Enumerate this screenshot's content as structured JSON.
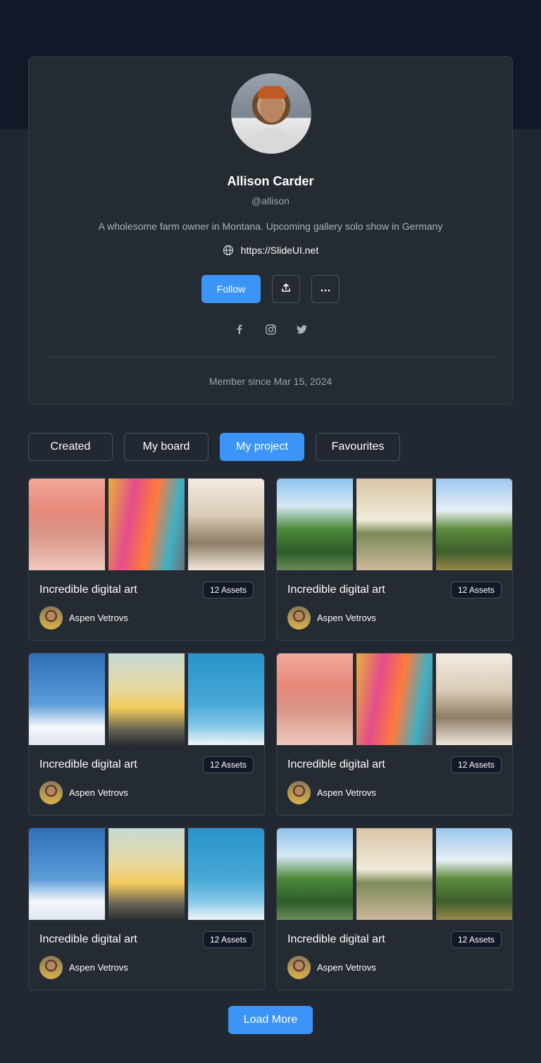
{
  "profile": {
    "name": "Allison Carder",
    "handle": "@allison",
    "bio": "A wholesome farm owner in Montana. Upcoming gallery solo show in Germany",
    "website": "https://SlideUI.net",
    "follow_label": "Follow",
    "member_since": "Member since Mar 15, 2024",
    "socials": [
      "facebook-icon",
      "instagram-icon",
      "twitter-icon"
    ]
  },
  "tabs": [
    {
      "label": "Created",
      "active": false
    },
    {
      "label": "My board",
      "active": false
    },
    {
      "label": "My project",
      "active": true
    },
    {
      "label": "Favourites",
      "active": false
    }
  ],
  "cards": [
    {
      "title": "Incredible digital art",
      "assets": "12 Assets",
      "author": "Aspen Vetrovs",
      "thumbs": [
        "t-pink",
        "t-bags",
        "t-mall"
      ]
    },
    {
      "title": "Incredible digital art",
      "assets": "12 Assets",
      "author": "Aspen Vetrovs",
      "thumbs": [
        "t-garden",
        "t-room",
        "t-house"
      ]
    },
    {
      "title": "Incredible digital art",
      "assets": "12 Assets",
      "author": "Aspen Vetrovs",
      "thumbs": [
        "t-sky",
        "t-run",
        "t-jump"
      ]
    },
    {
      "title": "Incredible digital art",
      "assets": "12 Assets",
      "author": "Aspen Vetrovs",
      "thumbs": [
        "t-pink",
        "t-bags",
        "t-mall"
      ]
    },
    {
      "title": "Incredible digital art",
      "assets": "12 Assets",
      "author": "Aspen Vetrovs",
      "thumbs": [
        "t-sky",
        "t-run",
        "t-jump"
      ]
    },
    {
      "title": "Incredible digital art",
      "assets": "12 Assets",
      "author": "Aspen Vetrovs",
      "thumbs": [
        "t-garden",
        "t-room",
        "t-house"
      ]
    }
  ],
  "load_more_label": "Load More",
  "colors": {
    "accent": "#3b94f6",
    "page_bg": "#222831",
    "header_band": "#111827",
    "card_bg": "#252b33",
    "border": "#3a414b"
  }
}
